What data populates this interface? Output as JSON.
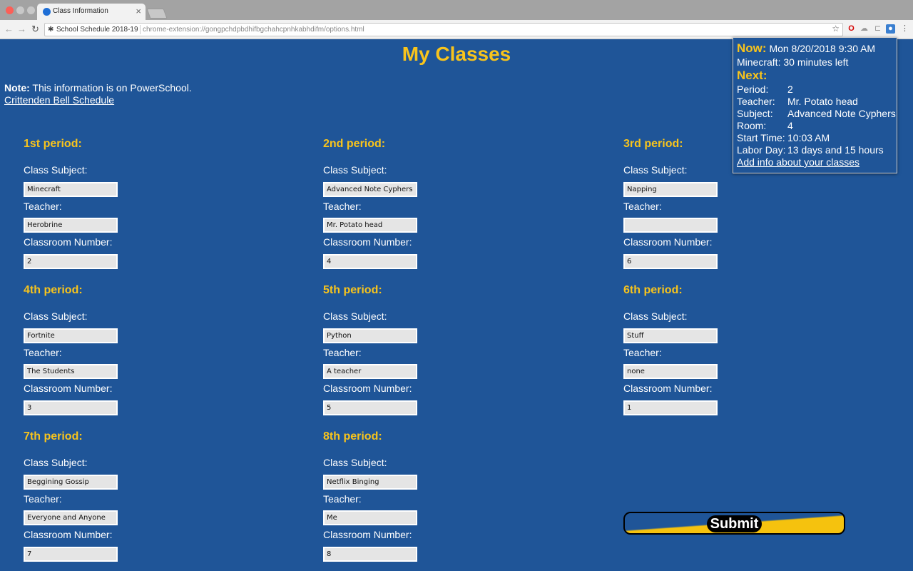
{
  "browser": {
    "tab_title": "Class Information",
    "omnibox_name": "School Schedule 2018-19",
    "url": "chrome-extension://gongpchdpbdhifbgchahcpnhkabhdifm/options.html"
  },
  "colors": {
    "background": "#1f5598",
    "accent": "#f8c41c"
  },
  "page": {
    "title": "My Classes",
    "note_label": "Note:",
    "note_text": "This information is on PowerSchool.",
    "bell_link": "Crittenden Bell Schedule",
    "labels": {
      "subject": "Class Subject:",
      "teacher": "Teacher:",
      "room": "Classroom Number:"
    },
    "periods": [
      {
        "heading": "1st period:",
        "subject": "Minecraft",
        "teacher": "Herobrine",
        "room": "2"
      },
      {
        "heading": "2nd period:",
        "subject": "Advanced Note Cyphers",
        "teacher": "Mr. Potato head",
        "room": "4"
      },
      {
        "heading": "3rd period:",
        "subject": "Napping",
        "teacher": "",
        "room": "6"
      },
      {
        "heading": "4th period:",
        "subject": "Fortnite",
        "teacher": "The Students",
        "room": "3"
      },
      {
        "heading": "5th period:",
        "subject": "Python",
        "teacher": "A teacher",
        "room": "5"
      },
      {
        "heading": "6th period:",
        "subject": "Stuff",
        "teacher": "none",
        "room": "1"
      },
      {
        "heading": "7th period:",
        "subject": "Beggining Gossip",
        "teacher": "Everyone and Anyone",
        "room": "7"
      },
      {
        "heading": "8th period:",
        "subject": "Netflix Binging",
        "teacher": "Me",
        "room": "8"
      }
    ],
    "submit_label": "Submit"
  },
  "popup": {
    "now_label": "Now:",
    "now_value": "Mon 8/20/2018 9:30 AM",
    "current_line": "Minecraft: 30 minutes left",
    "next_label": "Next:",
    "rows": [
      {
        "key": "Period:",
        "value": "2"
      },
      {
        "key": "Teacher:",
        "value": "Mr. Potato head"
      },
      {
        "key": "Subject:",
        "value": "Advanced Note Cyphers"
      },
      {
        "key": "Room:",
        "value": "4"
      },
      {
        "key": "Start Time:",
        "value": "10:03 AM"
      },
      {
        "key": "Labor Day:",
        "value": "13 days and 15 hours"
      }
    ],
    "link": "Add info about your classes"
  }
}
